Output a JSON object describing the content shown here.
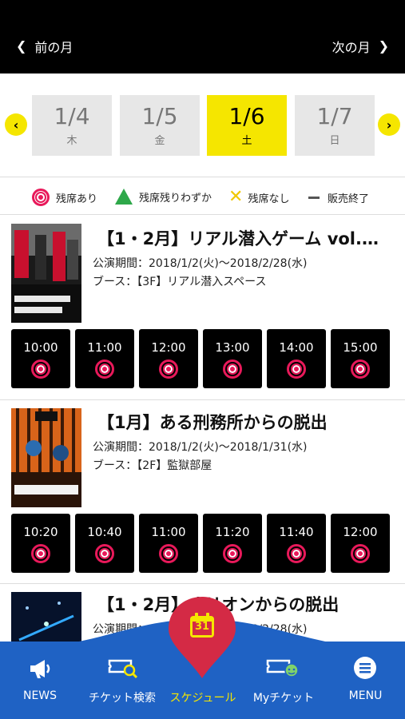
{
  "topbar": {
    "prev_label": "前の月",
    "next_label": "次の月"
  },
  "dates": [
    {
      "date": "1/4",
      "weekday": "木",
      "selected": false
    },
    {
      "date": "1/5",
      "weekday": "金",
      "selected": false
    },
    {
      "date": "1/6",
      "weekday": "土",
      "selected": true
    },
    {
      "date": "1/7",
      "weekday": "日",
      "selected": false
    }
  ],
  "legend": {
    "available": "残席あり",
    "few": "残席残りわずか",
    "none": "残席なし",
    "ended": "販売終了"
  },
  "events": [
    {
      "title": "【1・2月】リアル潜入ゲーム vol.…",
      "period": "公演期間：2018/1/2(火)～2018/2/28(水)",
      "booth": "ブース：【3F】リアル潜入スペース",
      "times": [
        "10:00",
        "11:00",
        "12:00",
        "13:00",
        "14:00",
        "15:00"
      ]
    },
    {
      "title": "【1月】ある刑務所からの脱出",
      "period": "公演期間：2018/1/2(火)～2018/1/31(水)",
      "booth": "ブース：【2F】監獄部屋",
      "times": [
        "10:20",
        "10:40",
        "11:00",
        "11:20",
        "11:40",
        "12:00"
      ]
    },
    {
      "title": "【1・2月】オリオンからの脱出",
      "period": "公演期間：2018/1/2(火)～2018/2/28(水)"
    }
  ],
  "tabs": [
    {
      "label": "NEWS",
      "icon": "megaphone-icon"
    },
    {
      "label": "チケット検索",
      "icon": "ticket-search-icon"
    },
    {
      "label": "スケジュール",
      "icon": "calendar-icon",
      "active": true
    },
    {
      "label": "Myチケット",
      "icon": "my-ticket-icon"
    },
    {
      "label": "MENU",
      "icon": "menu-icon"
    }
  ],
  "calendar_day": "31",
  "colors": {
    "accent_yellow": "#f5e600",
    "tab_blue": "#1f62c4",
    "available_red": "#e8195a",
    "few_green": "#2ea84a"
  }
}
